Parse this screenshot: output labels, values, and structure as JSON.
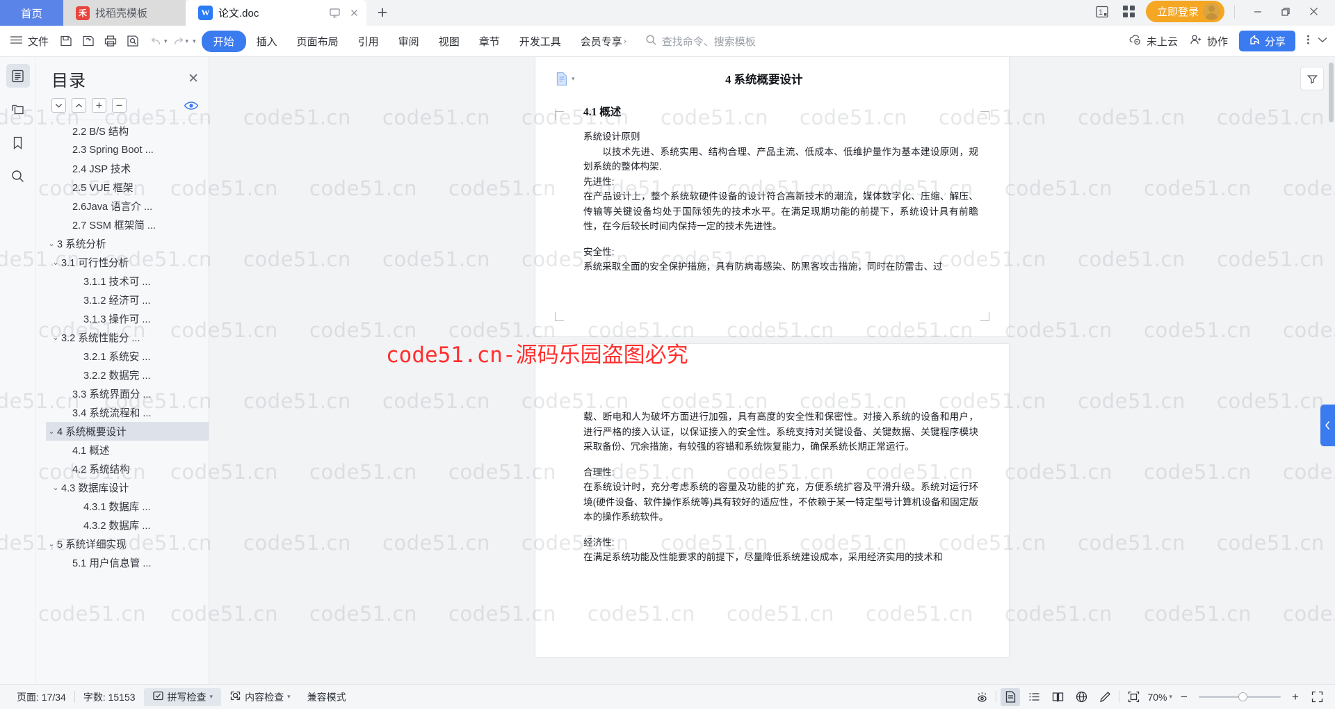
{
  "titlebar": {
    "tabs": [
      {
        "label": "首页",
        "icon": "home-tab",
        "type": "home"
      },
      {
        "label": "找稻壳模板",
        "icon": "docer-icon",
        "type": "template"
      },
      {
        "label": "论文.doc",
        "icon": "wps-writer-icon",
        "type": "document"
      }
    ],
    "new_tab_label": "+",
    "doc_tab_icons": [
      "monitor-icon",
      "close-icon"
    ],
    "right_icons": [
      "window-count-icon",
      "grid-apps-icon"
    ],
    "login_label": "立即登录",
    "window_controls": {
      "minimize": "—",
      "restore": "❐",
      "close": "✕"
    }
  },
  "ribbon": {
    "menu_label": "文件",
    "quick_icons": [
      "save-icon",
      "save-as-cloud-icon",
      "print-icon",
      "print-preview-icon",
      "undo-icon",
      "redo-icon",
      "customize-icon"
    ],
    "tabs": [
      {
        "label": "开始",
        "active": true
      },
      {
        "label": "插入",
        "active": false
      },
      {
        "label": "页面布局",
        "active": false
      },
      {
        "label": "引用",
        "active": false
      },
      {
        "label": "审阅",
        "active": false
      },
      {
        "label": "视图",
        "active": false
      },
      {
        "label": "章节",
        "active": false
      },
      {
        "label": "开发工具",
        "active": false
      },
      {
        "label": "会员专享",
        "active": false,
        "arrow": "›"
      }
    ],
    "search_placeholder": "查找命令、搜索模板",
    "cloud_status": "未上云",
    "collab_label": "协作",
    "share_label": "分享"
  },
  "rail": {
    "items": [
      {
        "name": "outline-panel",
        "active": true
      },
      {
        "name": "thumbnail-panel",
        "active": false
      },
      {
        "name": "bookmark-panel",
        "active": false
      },
      {
        "name": "search-panel",
        "active": false
      }
    ]
  },
  "toc": {
    "title": "目录",
    "close_label": "✕",
    "tools": [
      "collapse-down",
      "collapse-up",
      "expand-all",
      "collapse-all"
    ],
    "items": [
      {
        "text": "2.2 B/S 结构",
        "level": 2,
        "arrow": "none",
        "selected": false
      },
      {
        "text": "2.3 Spring Boot ...",
        "level": 2,
        "arrow": "none",
        "selected": false
      },
      {
        "text": "2.4 JSP 技术",
        "level": 2,
        "arrow": "none",
        "selected": false
      },
      {
        "text": "2.5 VUE 框架",
        "level": 2,
        "arrow": "none",
        "selected": false
      },
      {
        "text": "2.6Java 语言介 ...",
        "level": 2,
        "arrow": "none",
        "selected": false
      },
      {
        "text": "2.7 SSM 框架简 ...",
        "level": 2,
        "arrow": "none",
        "selected": false
      },
      {
        "text": "3 系统分析",
        "level": 0,
        "arrow": "down",
        "selected": false
      },
      {
        "text": "3.1 可行性分析",
        "level": 1,
        "arrow": "down",
        "selected": false
      },
      {
        "text": "3.1.1 技术可 ...",
        "level": 3,
        "arrow": "none",
        "selected": false
      },
      {
        "text": "3.1.2 经济可 ...",
        "level": 3,
        "arrow": "none",
        "selected": false
      },
      {
        "text": "3.1.3 操作可 ...",
        "level": 3,
        "arrow": "none",
        "selected": false
      },
      {
        "text": "3.2 系统性能分 ...",
        "level": 1,
        "arrow": "down",
        "selected": false
      },
      {
        "text": "3.2.1  系统安 ...",
        "level": 3,
        "arrow": "none",
        "selected": false
      },
      {
        "text": "3.2.2  数据完 ...",
        "level": 3,
        "arrow": "none",
        "selected": false
      },
      {
        "text": "3.3 系统界面分 ...",
        "level": 2,
        "arrow": "none",
        "selected": false
      },
      {
        "text": "3.4 系统流程和 ...",
        "level": 2,
        "arrow": "none",
        "selected": false
      },
      {
        "text": "4 系统概要设计",
        "level": 0,
        "arrow": "down",
        "selected": true
      },
      {
        "text": "4.1 概述",
        "level": 2,
        "arrow": "none",
        "selected": false
      },
      {
        "text": "4.2 系统结构",
        "level": 2,
        "arrow": "none",
        "selected": false
      },
      {
        "text": "4.3 数据库设计",
        "level": 1,
        "arrow": "down",
        "selected": false
      },
      {
        "text": "4.3.1 数据库 ...",
        "level": 3,
        "arrow": "none",
        "selected": false
      },
      {
        "text": "4.3.2 数据库 ...",
        "level": 3,
        "arrow": "none",
        "selected": false
      },
      {
        "text": "5 系统详细实现",
        "level": 0,
        "arrow": "down",
        "selected": false
      },
      {
        "text": "5.1 用户信息管 ...",
        "level": 2,
        "arrow": "none",
        "selected": false
      }
    ]
  },
  "document": {
    "page1": {
      "header_title": "4 系统概要设计",
      "heading": "4.1 概述",
      "paragraphs": [
        "系统设计原则",
        "以技术先进、系统实用、结构合理、产品主流、低成本、低维护量作为基本建设原则，规划系统的整体构架.",
        "先进性:",
        "在产品设计上，整个系统软硬件设备的设计符合高新技术的潮流，媒体数字化、压缩、解压、传输等关键设备均处于国际领先的技术水平。在满足现期功能的前提下，系统设计具有前瞻性，在今后较长时间内保持一定的技术先进性。",
        "安全性:",
        "系统采取全面的安全保护措施，具有防病毒感染、防黑客攻击措施，同时在防雷击、过"
      ]
    },
    "page2": {
      "paragraphs": [
        "载、断电和人为破坏方面进行加强，具有高度的安全性和保密性。对接入系统的设备和用户，进行严格的接入认证，以保证接入的安全性。系统支持对关键设备、关键数据、关键程序模块采取备份、冗余措施，有较强的容错和系统恢复能力，确保系统长期正常运行。",
        "合理性:",
        "在系统设计时，充分考虑系统的容量及功能的扩充，方便系统扩容及平滑升级。系统对运行环境(硬件设备、软件操作系统等)具有较好的适应性，不依赖于某一特定型号计算机设备和固定版本的操作系统软件。",
        "经济性:",
        "在满足系统功能及性能要求的前提下，尽量降低系统建设成本，采用经济实用的技术和"
      ]
    }
  },
  "watermark": {
    "text": "code51.cn",
    "red_text": "code51.cn-源码乐园盗图必究",
    "red_color": "#ff2f2f"
  },
  "statusbar": {
    "page_label": "页面: 17/34",
    "word_count_label": "字数: 15153",
    "spellcheck_label": "拼写检查",
    "content_check_label": "内容检查",
    "compat_mode_label": "兼容模式",
    "view_icons": [
      "eye-protect-icon",
      "print-layout-icon",
      "outline-view-icon",
      "reading-view-icon",
      "web-layout-icon",
      "writing-mode-icon"
    ],
    "fit_icon": "fit-page-icon",
    "zoom_value": "70%",
    "zoom_out": "−",
    "zoom_in": "+",
    "fullscreen_icon": "fullscreen-icon"
  }
}
